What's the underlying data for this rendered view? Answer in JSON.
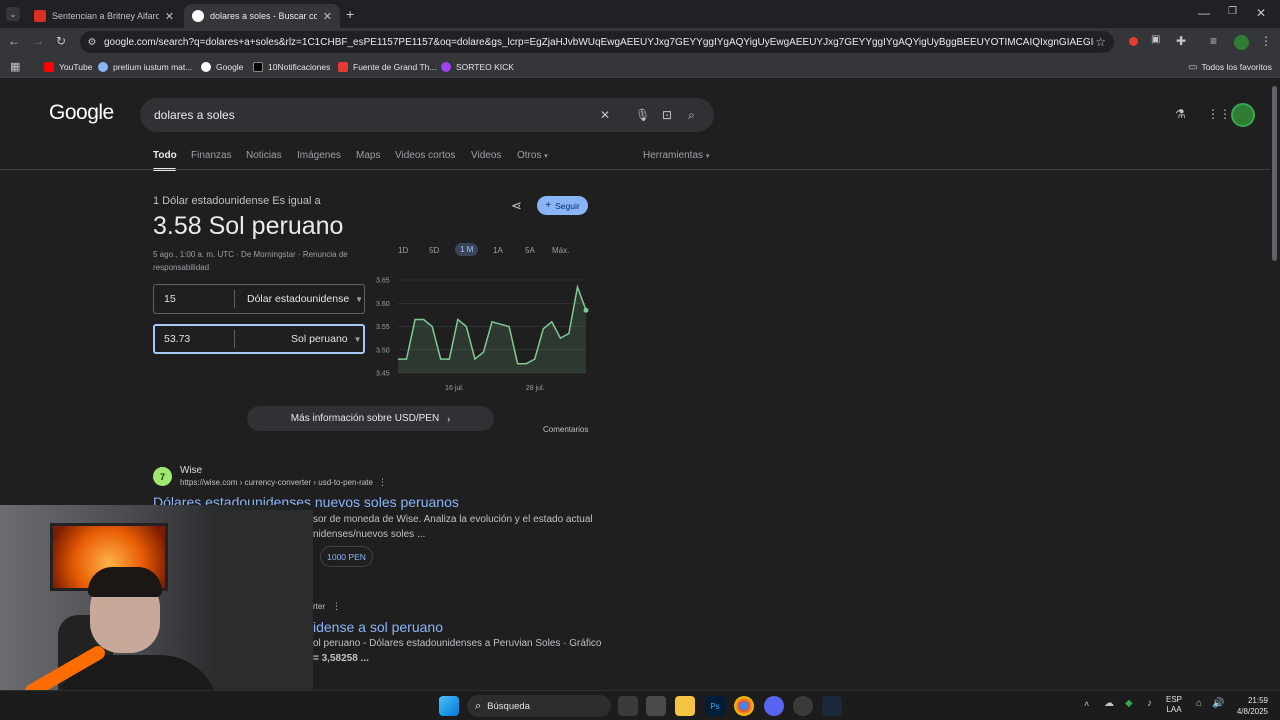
{
  "browser": {
    "tabs": [
      {
        "title": "Sentencian a Britney Alfaro, ex",
        "favicon_color": "#d93025"
      },
      {
        "title": "dolares a soles - Buscar con Go",
        "favicon_color": "#8ab4f8"
      }
    ],
    "url": "google.com/search?q=dolares+a+soles&rlz=1C1CHBF_esPE1157PE1157&oq=dolare&gs_lcrp=EgZjaHJvbWUqEwgAEEUYJxg7GEYYggIYgAQYigUyEwgAEEUYJxg7GEYYggIYgAQYigUyBggBEEUYOTIMCAIQIxgnGIAEGIoFMgoIAxAAGLEDGIAE...",
    "bookmarks": [
      {
        "label": "YouTube",
        "color": "#ff0000"
      },
      {
        "label": "pretium iustum mat...",
        "color": "#8ab4f8"
      },
      {
        "label": "Google",
        "color": "#8ab4f8"
      },
      {
        "label": "10Notificaciones",
        "color": "#e8eaed"
      },
      {
        "label": "Fuente de Grand Th...",
        "color": "#e53935"
      },
      {
        "label": "SORTEO KICK",
        "color": "#a142f4"
      }
    ],
    "all_bookmarks": "Todos los favoritos"
  },
  "search": {
    "logo": "Google",
    "query": "dolares a soles",
    "tabs": [
      "Todo",
      "Finanzas",
      "Noticias",
      "Imágenes",
      "Maps",
      "Videos cortos",
      "Videos",
      "Otros"
    ],
    "tools": "Herramientas"
  },
  "converter": {
    "subtitle": "1 Dólar estadounidense Es igual a",
    "result": "3.58 Sol peruano",
    "meta_line1": "5 ago., 1:00 a. m. UTC · De Morningstar · Renuncia de",
    "meta_line2": "responsabilidad",
    "follow": "Seguir",
    "from_value": "15",
    "from_currency": "Dólar estadounidense",
    "to_value": "53.73",
    "to_currency": "Sol peruano",
    "ranges": [
      "1D",
      "5D",
      "1 M",
      "1A",
      "5A",
      "Máx."
    ],
    "more_info": "Más información sobre USD/PEN",
    "comments": "Comentarios",
    "line_color": "#81c995"
  },
  "chart_data": {
    "type": "line",
    "y_ticks": [
      "3.65",
      "3.60",
      "3.55",
      "3.50",
      "3.45"
    ],
    "x_ticks": [
      "16 jul.",
      "28 jul."
    ],
    "ylim": [
      3.45,
      3.65
    ],
    "values": [
      3.48,
      3.48,
      3.565,
      3.565,
      3.55,
      3.48,
      3.48,
      3.565,
      3.55,
      3.48,
      3.495,
      3.56,
      3.555,
      3.55,
      3.47,
      3.47,
      3.48,
      3.545,
      3.56,
      3.525,
      3.535,
      3.635,
      3.585
    ]
  },
  "results": [
    {
      "site": "Wise",
      "url": "https://wise.com › currency-converter › usd-to-pen-rate",
      "title": "Dólares estadounidenses nuevos soles peruanos",
      "snippet1": "sor de moneda de Wise. Analiza la evolución y el estado actual",
      "snippet2": "nidenses/nuevos soles ...",
      "chip": "1000 PEN"
    },
    {
      "url_tail": "rter",
      "title": "idense a sol peruano",
      "snippet1": "ol peruano - Dólares estadounidenses a Peruvian Soles · Gráfico",
      "snippet2": "= 3,58258 ..."
    }
  ],
  "taskbar": {
    "search": "Búsqueda",
    "lang1": "ESP",
    "lang2": "LAA",
    "time": "21:59",
    "date": "4/8/2025"
  }
}
